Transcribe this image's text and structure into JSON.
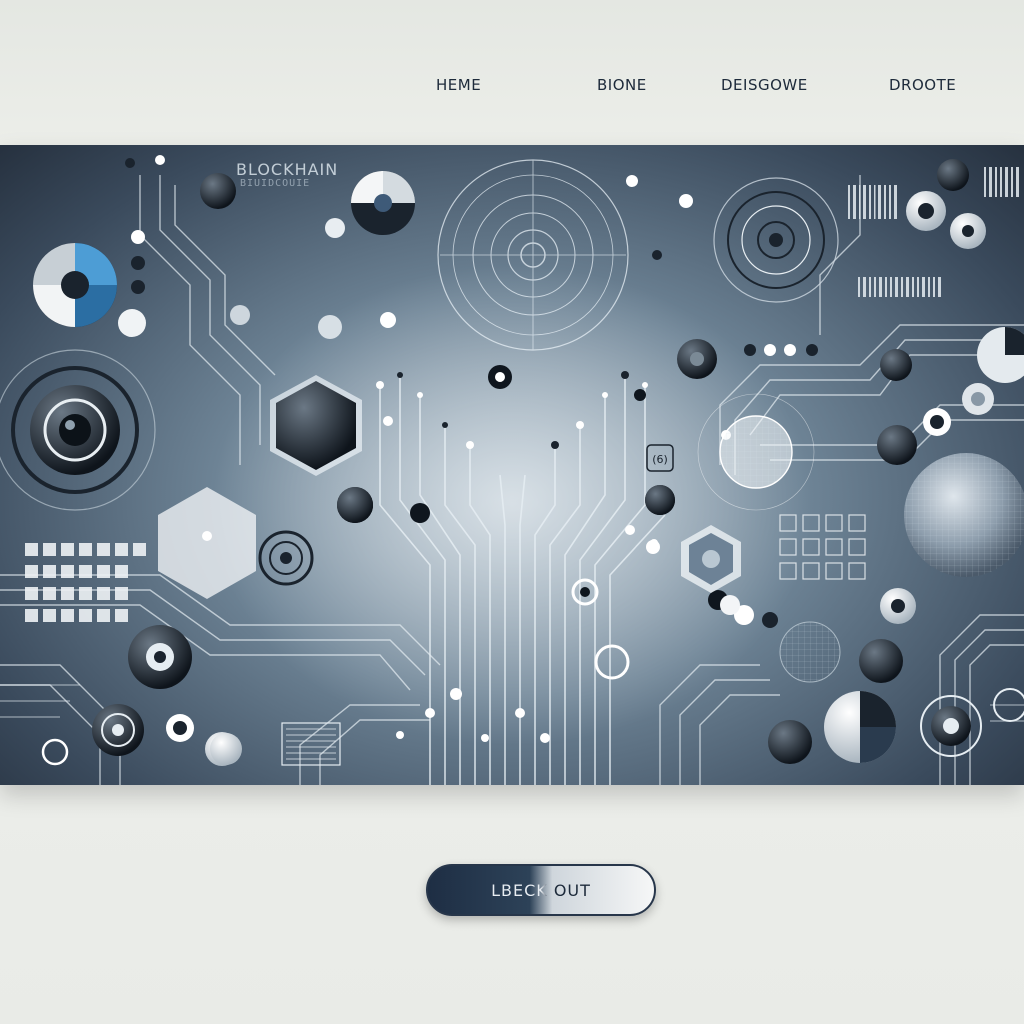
{
  "nav": {
    "items": [
      {
        "label": "HEME"
      },
      {
        "label": "BIONE"
      },
      {
        "label": "DEISGOWE"
      },
      {
        "label": "DROOTE"
      }
    ]
  },
  "hero": {
    "title": "BLOCKHAIN",
    "subtitle": "BIUIDCOUIE",
    "badge": "(6)"
  },
  "cta": {
    "label": "LBECK OUT"
  },
  "colors": {
    "navy": "#1d2a3a",
    "hero_dark": "#26313f",
    "hero_mid": "#6f8597",
    "hero_light": "#a9bbc8",
    "circuit": "#e6eef3",
    "background": "#eceee9"
  },
  "icons": [
    "circuit-trace-icon",
    "gear-dial-icon",
    "hexagon-icon",
    "globe-icon",
    "pie-gauge-icon"
  ]
}
